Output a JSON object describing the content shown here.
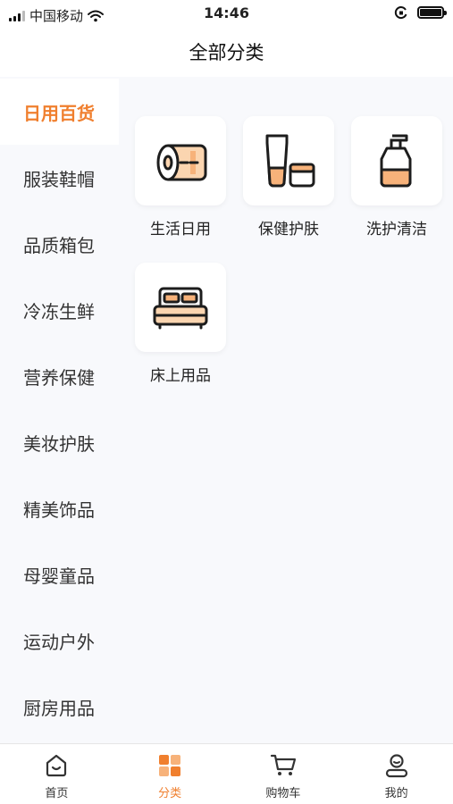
{
  "status_bar": {
    "carrier": "中国移动",
    "time": "14:46"
  },
  "header": {
    "title": "全部分类"
  },
  "sidebar": {
    "active_index": 0,
    "items": [
      {
        "label": "日用百货"
      },
      {
        "label": "服装鞋帽"
      },
      {
        "label": "品质箱包"
      },
      {
        "label": "冷冻生鲜"
      },
      {
        "label": "营养保健"
      },
      {
        "label": "美妆护肤"
      },
      {
        "label": "精美饰品"
      },
      {
        "label": "母婴童品"
      },
      {
        "label": "运动户外"
      },
      {
        "label": "厨房用品"
      }
    ]
  },
  "categories": [
    {
      "label": "生活日用",
      "icon": "toilet-paper-icon"
    },
    {
      "label": "保健护肤",
      "icon": "skincare-tube-icon"
    },
    {
      "label": "洗护清洁",
      "icon": "soap-pump-icon"
    },
    {
      "label": "床上用品",
      "icon": "bed-icon"
    }
  ],
  "tabbar": {
    "active_index": 1,
    "items": [
      {
        "label": "首页",
        "icon": "home-icon"
      },
      {
        "label": "分类",
        "icon": "category-grid-icon"
      },
      {
        "label": "购物车",
        "icon": "cart-icon"
      },
      {
        "label": "我的",
        "icon": "profile-icon"
      }
    ]
  },
  "colors": {
    "accent": "#f07f2e",
    "accent_light": "#f7b27a",
    "background": "#f8f9fc",
    "text": "#222222"
  }
}
